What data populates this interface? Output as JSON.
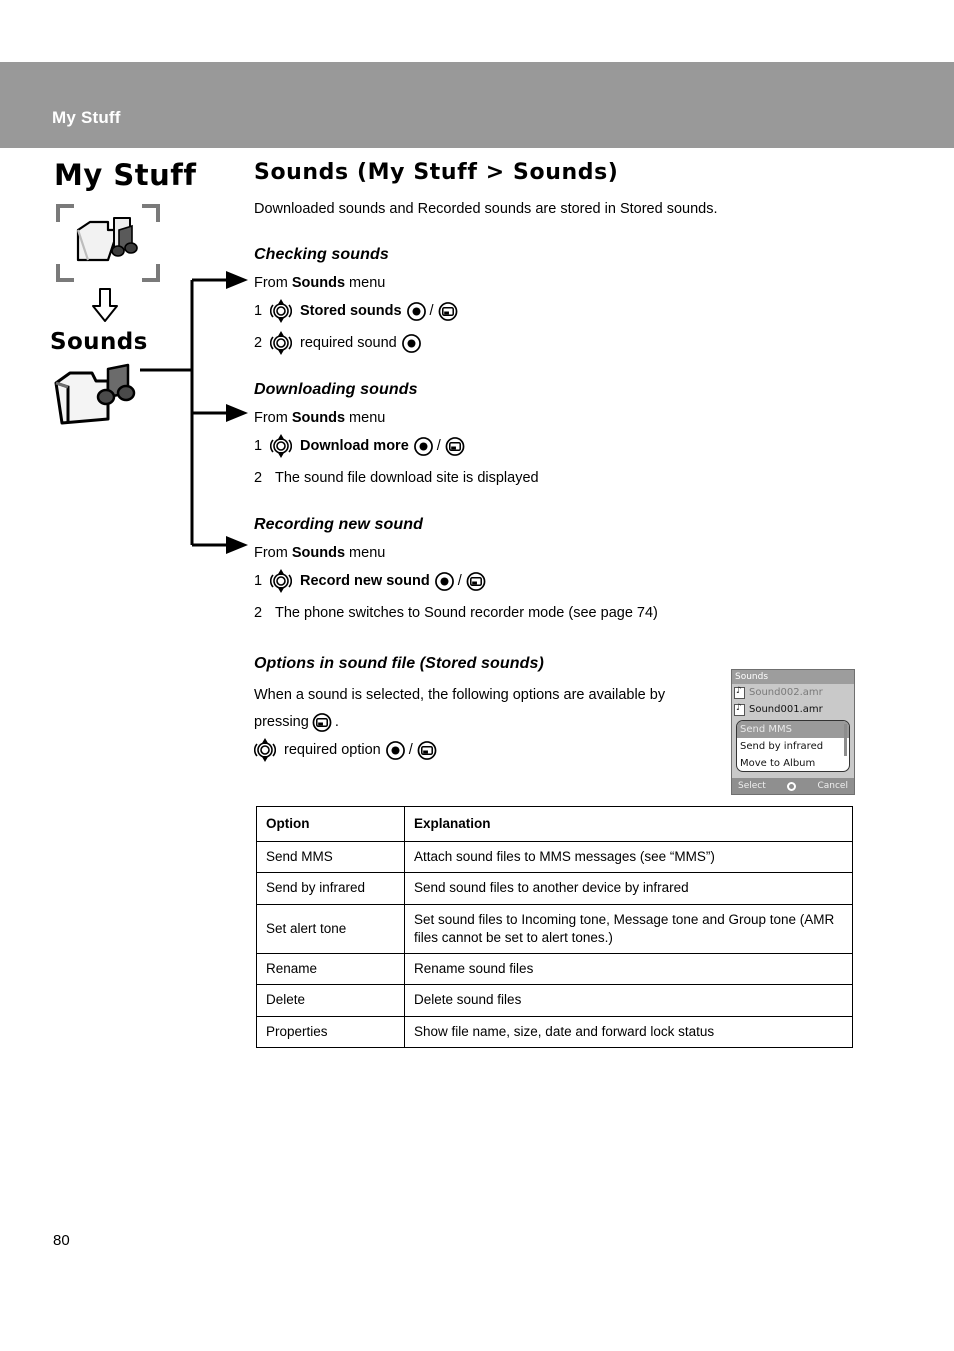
{
  "header": {
    "title": "My Stuff"
  },
  "sidebar": {
    "title": "My Stuff",
    "sub": "Sounds",
    "icons": {
      "top": "folder-music-framed-icon",
      "arrow": "down-arrow-icon",
      "bottom": "sounds-folder-icon"
    }
  },
  "main": {
    "section_title": "Sounds (My Stuff > Sounds)",
    "lead": "Downloaded sounds and Recorded sounds are stored in Stored sounds.",
    "sections": [
      {
        "heading": "Checking sounds",
        "from_prefix": "From ",
        "from_bold": "Sounds",
        "from_suffix": " menu",
        "steps": [
          {
            "num": "1",
            "nav": true,
            "text": "Stored sounds",
            "bold": true,
            "select": true,
            "sep": "/",
            "softkey": true
          },
          {
            "num": "2",
            "nav": true,
            "text": "required sound",
            "bold": false,
            "select": true,
            "sep": "",
            "softkey": false
          }
        ]
      },
      {
        "heading": "Downloading sounds",
        "from_prefix": "From ",
        "from_bold": "Sounds",
        "from_suffix": " menu",
        "steps": [
          {
            "num": "1",
            "nav": true,
            "text": "Download more",
            "bold": true,
            "select": true,
            "sep": "/",
            "softkey": true
          },
          {
            "num": "2",
            "nav": false,
            "text": "The sound file download site is displayed",
            "bold": false,
            "select": false,
            "sep": "",
            "softkey": false
          }
        ]
      },
      {
        "heading": "Recording new sound",
        "from_prefix": "From ",
        "from_bold": "Sounds",
        "from_suffix": " menu",
        "steps": [
          {
            "num": "1",
            "nav": true,
            "text": "Record new sound",
            "bold": true,
            "select": true,
            "sep": "/",
            "softkey": true
          },
          {
            "num": "2",
            "nav": false,
            "text": "The phone switches to Sound recorder mode (see page 74)",
            "bold": false,
            "select": false,
            "sep": "",
            "softkey": false
          }
        ]
      }
    ],
    "options_section": {
      "heading": "Options in sound file (Stored sounds)",
      "body_part1": "When a sound is selected, the following options are available by",
      "body_part2": "pressing",
      "body_part3": ".",
      "step_text": "required option",
      "sep": "/"
    }
  },
  "phone_screenshot": {
    "title": "Sounds",
    "files": [
      {
        "name": "Sound002.amr",
        "dim": true
      },
      {
        "name": "Sound001.amr",
        "dim": false
      }
    ],
    "popup_options": [
      {
        "label": "Send MMS",
        "selected": true
      },
      {
        "label": "Send by infrared",
        "selected": false
      },
      {
        "label": "Move to Album",
        "selected": false
      }
    ],
    "softkeys": {
      "left": "Select",
      "center": "ok-button-icon",
      "right": "Cancel"
    }
  },
  "options_table": {
    "headers": [
      "Option",
      "Explanation"
    ],
    "rows": [
      [
        "Send MMS",
        "Attach sound files to MMS messages (see “MMS”)"
      ],
      [
        "Send by infrared",
        "Send sound files to another device by infrared"
      ],
      [
        "Set alert tone",
        "Set sound files to Incoming tone, Message tone and Group tone (AMR files cannot be set to alert tones.)"
      ],
      [
        "Rename",
        "Rename sound files"
      ],
      [
        "Delete",
        "Delete sound files"
      ],
      [
        "Properties",
        "Show file name, size, date and forward lock status"
      ]
    ]
  },
  "footer": {
    "page_number": "80"
  },
  "colors": {
    "header_band": "#999999",
    "header_text": "#ffffff",
    "phone_titlebar": "#9d9d9d",
    "phone_bg": "#c9c9c9",
    "popup_selected": "#9a9a9a"
  }
}
